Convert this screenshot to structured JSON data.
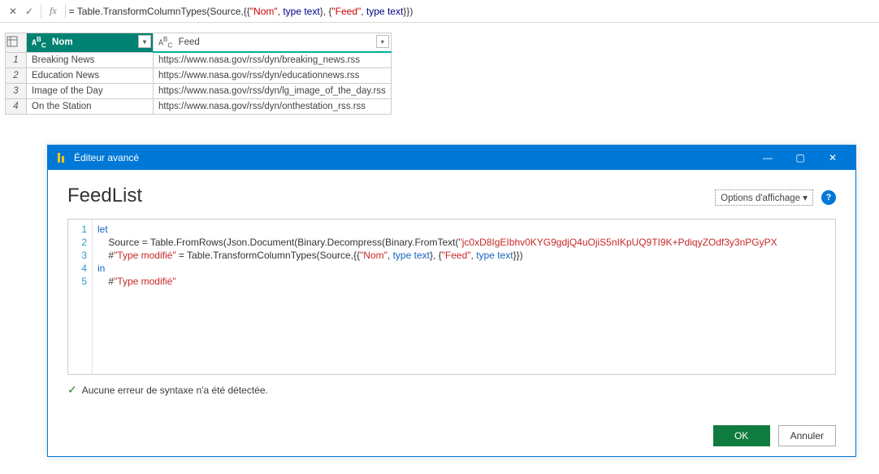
{
  "formula_bar": {
    "fx": "fx",
    "text_prefix": "= Table.TransformColumnTypes(Source,{{",
    "str_nom": "\"Nom\"",
    "sep1": ", ",
    "kw_type1": "type",
    "sep1b": " ",
    "kw_text1": "text",
    "sep2": "}, {",
    "str_feed": "\"Feed\"",
    "sep3": ", ",
    "kw_type2": "type",
    "sep3b": " ",
    "kw_text2": "text",
    "suffix": "}})"
  },
  "table": {
    "headers": {
      "nom": "Nom",
      "feed": "Feed"
    },
    "type_icon": "A",
    "type_icon_sup": "B",
    "type_icon_sub": "C",
    "rows": [
      {
        "num": "1",
        "nom": "Breaking News",
        "feed": "https://www.nasa.gov/rss/dyn/breaking_news.rss"
      },
      {
        "num": "2",
        "nom": "Education News",
        "feed": "https://www.nasa.gov/rss/dyn/educationnews.rss"
      },
      {
        "num": "3",
        "nom": "Image of the Day",
        "feed": "https://www.nasa.gov/rss/dyn/lg_image_of_the_day.rss"
      },
      {
        "num": "4",
        "nom": "On the Station",
        "feed": "https://www.nasa.gov/rss/dyn/onthestation_rss.rss"
      }
    ]
  },
  "dialog": {
    "title": "Éditeur avancé",
    "heading": "FeedList",
    "display_options": "Options d'affichage ▾",
    "help": "?",
    "status": "Aucune erreur de syntaxe n'a été détectée.",
    "ok": "OK",
    "cancel": "Annuler",
    "win": {
      "min": "—",
      "max": "▢",
      "close": "✕"
    },
    "code": {
      "line_nums": [
        "1",
        "2",
        "3",
        "4",
        "5"
      ],
      "l1_kw": "let",
      "l2_indent": "    ",
      "l2_a": "Source = Table.FromRows(Json.Document(Binary.Decompress(Binary.FromText(",
      "l2_str": "\"jc0xD8IgEIbhv0KYG9gdjQ4uOjiS5nIKpUQ9TI9K+PdiqyZOdf3y3nPGyPX",
      "l3_indent": "    ",
      "l3_a": "#",
      "l3_str1": "\"Type modifié\"",
      "l3_b": " = Table.TransformColumnTypes(Source,{{",
      "l3_str2": "\"Nom\"",
      "l3_c": ", ",
      "l3_kw1": "type",
      "l3_sp1": " ",
      "l3_kw2": "text",
      "l3_d": "}, {",
      "l3_str3": "\"Feed\"",
      "l3_e": ", ",
      "l3_kw3": "type",
      "l3_sp2": " ",
      "l3_kw4": "text",
      "l3_f": "}})",
      "l4_kw": "in",
      "l5_indent": "    ",
      "l5_a": "#",
      "l5_str": "\"Type modifié\""
    }
  }
}
